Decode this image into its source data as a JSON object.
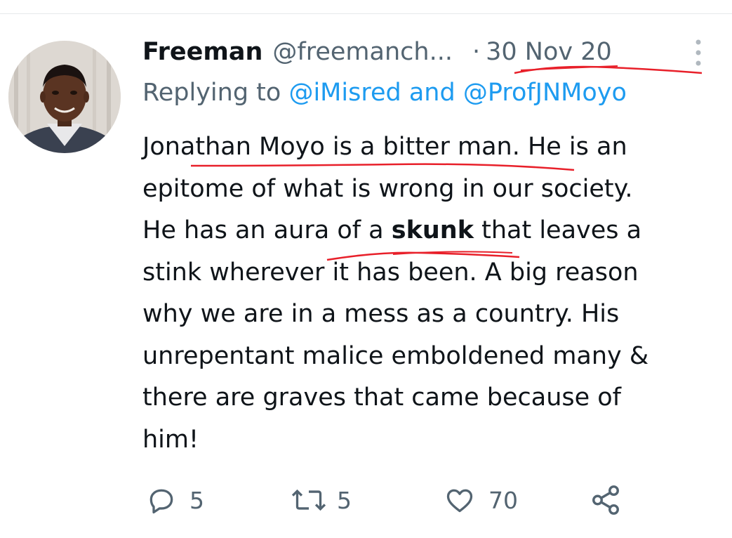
{
  "tweet": {
    "author_name": "Freeman",
    "author_handle": "@freemanch...",
    "separator": "·",
    "date": "30 Nov 20",
    "reply_prefix": "Replying to ",
    "reply_mention_1": "@iMisred",
    "reply_and": " and ",
    "reply_mention_2": "@ProfJNMoyo",
    "text": {
      "line1": "Jonathan Moyo is a bitter man. He is an",
      "line2": "epitome of what is wrong in our society.",
      "line3_a": "He has an aura of a ",
      "line3_bold": "skunk",
      "line3_b": " that leaves a",
      "line4": "stink wherever it has been. A big reason",
      "line5": "why we are in a mess as a country. His",
      "line6": "unrepentant malice emboldened many &",
      "line7": "there are graves that came because of",
      "line8": "him!"
    }
  },
  "actions": {
    "reply_count": "5",
    "retweet_count": "5",
    "like_count": "70"
  },
  "icons": {
    "more": "more-options-icon",
    "reply": "reply-icon",
    "retweet": "retweet-icon",
    "like": "heart-icon",
    "share": "share-icon"
  },
  "colors": {
    "text": "#0f1419",
    "secondary": "#536471",
    "link": "#1d9bf0",
    "annotation": "#e8202a"
  }
}
